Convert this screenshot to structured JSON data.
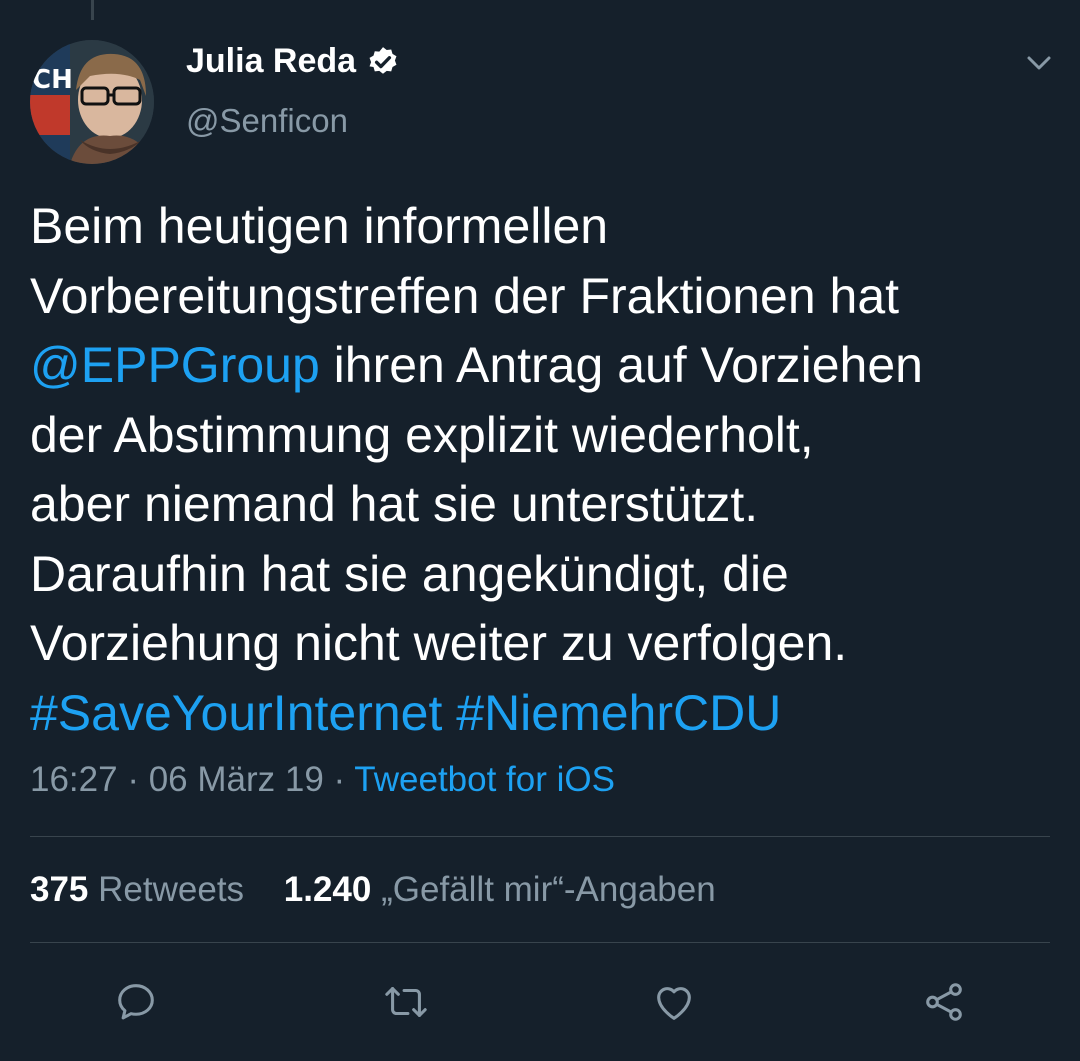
{
  "author": {
    "name": "Julia Reda",
    "handle": "@Senficon",
    "avatar_text": "CH"
  },
  "tweet": {
    "lines": [
      [
        {
          "t": "Beim heutigen informellen",
          "link": false
        }
      ],
      [
        {
          "t": "Vorbereitungstreffen der Fraktionen hat",
          "link": false
        }
      ],
      [
        {
          "t": "@EPPGroup",
          "link": true
        },
        {
          "t": " ihren Antrag auf Vorziehen",
          "link": false
        }
      ],
      [
        {
          "t": "der Abstimmung explizit wiederholt,",
          "link": false
        }
      ],
      [
        {
          "t": "aber niemand hat sie unterstützt.",
          "link": false
        }
      ],
      [
        {
          "t": "Daraufhin hat sie angekündigt, die",
          "link": false
        }
      ],
      [
        {
          "t": "Vorziehung nicht weiter zu verfolgen.",
          "link": false
        }
      ],
      [
        {
          "t": "#SaveYourInternet",
          "link": true
        },
        {
          "t": " ",
          "link": false
        },
        {
          "t": "#NiemehrCDU",
          "link": true
        }
      ]
    ]
  },
  "meta": {
    "time": "16:27",
    "date": "06 März 19",
    "separator": "·",
    "source": "Tweetbot for iOS"
  },
  "stats": {
    "retweets_count": "375",
    "retweets_label": "Retweets",
    "likes_count": "1.240",
    "likes_label": "„Gefällt mir“-Angaben"
  },
  "icons": {
    "verified": "verified-badge-icon",
    "caret": "chevron-down-icon",
    "reply": "reply-icon",
    "retweet": "retweet-icon",
    "like": "heart-icon",
    "share": "share-icon"
  },
  "colors": {
    "background": "#15202b",
    "link": "#1da1f2",
    "secondary_text": "#8899a6",
    "divider": "#38444d"
  }
}
